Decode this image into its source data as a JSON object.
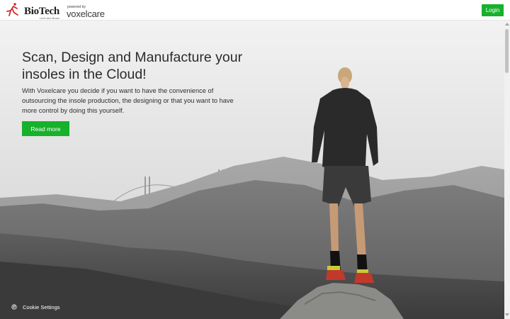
{
  "header": {
    "brand": "BioTech",
    "brand_tagline": "Limb and Brace",
    "powered_by": "powered by",
    "partner": "voxelcare",
    "login_label": "Login"
  },
  "hero": {
    "title": "Scan, Design and Manufacture your insoles in the Cloud!",
    "description": "With Voxelcare you decide if you want to have the convenience of outsourcing the insole production, the designing or that you want to have more control by doing this yourself.",
    "cta_label": "Read more"
  },
  "cookie": {
    "label": "Cookie Settings",
    "icon": "fingerprint-icon"
  },
  "colors": {
    "accent": "#17b12b",
    "logo_red": "#d12a2a"
  }
}
